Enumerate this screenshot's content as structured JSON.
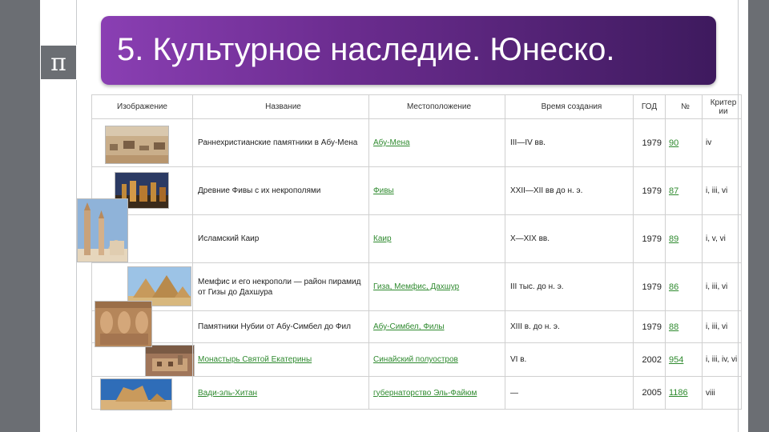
{
  "title": "5. Культурное наследие. Юнеско.",
  "pi_symbol": "π",
  "table": {
    "headers": [
      "Изображение",
      "Название",
      "Местоположение",
      "Время создания",
      "ГОД",
      "№",
      "Критер ии"
    ],
    "rows": [
      {
        "name": "Раннехристианские памятники в Абу-Мена",
        "name_link": false,
        "location": "Абу-Мена",
        "time": "III—IV вв.",
        "year": "1979",
        "num": "90",
        "criteria": "iv",
        "image": "desert-ruins"
      },
      {
        "name": "Древние Фивы с их некрополями",
        "name_link": false,
        "location": "Фивы",
        "time": "XXII—XII вв до н. э.",
        "year": "1979",
        "num": "87",
        "criteria": "i, iii, vi",
        "image": "temple-night"
      },
      {
        "name": "Исламский Каир",
        "name_link": false,
        "location": "Каир",
        "time": "X—XIX вв.",
        "year": "1979",
        "num": "89",
        "criteria": "i, v, vi",
        "image": "minarets"
      },
      {
        "name": "Мемфис и его некрополи — район пирамид от Гизы до Дахшура",
        "name_link": false,
        "location": "Гиза, Мемфис, Дахшур",
        "time": "III тыс. до н. э.",
        "year": "1979",
        "num": "86",
        "criteria": "i, iii, vi",
        "image": "pyramids"
      },
      {
        "name": "Памятники Нубии от Абу-Симбел до Фил",
        "name_link": false,
        "location": "Абу-Симбел, Филы",
        "time": "XIII в. до н. э.",
        "year": "1979",
        "num": "88",
        "criteria": "i, iii, vi",
        "image": "abu-simbel"
      },
      {
        "name": "Монастырь Святой Екатерины",
        "name_link": true,
        "location": "Синайский полуостров",
        "time": "VI в.",
        "year": "2002",
        "num": "954",
        "criteria": "i, iii, iv, vi",
        "image": "monastery"
      },
      {
        "name": "Вади-эль-Хитан",
        "name_link": true,
        "location": "губернаторство Эль-Файюм",
        "time": "—",
        "year": "2005",
        "num": "1186",
        "criteria": "viii",
        "image": "desert-rocks"
      }
    ]
  },
  "colors": {
    "title_start": "#8a3fb3",
    "title_end": "#3e1a5e",
    "link": "#2f8a2f",
    "sidebar": "#6b6e73"
  }
}
